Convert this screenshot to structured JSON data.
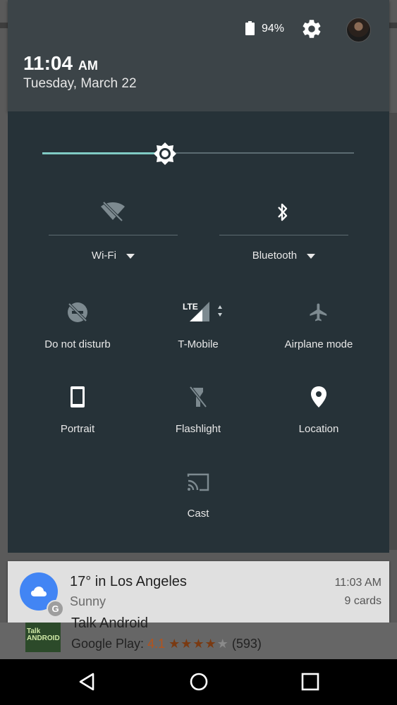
{
  "status_bar": {
    "battery_percent": "94%",
    "battery_icon": "battery-icon",
    "settings_icon": "gear-icon",
    "avatar_icon": "user-avatar"
  },
  "header": {
    "time": "11:04",
    "ampm": "AM",
    "date": "Tuesday, March 22"
  },
  "brightness": {
    "level": 0.4,
    "accent": "#80cbc4"
  },
  "quick_settings": {
    "wifi": {
      "label": "Wi-Fi",
      "icon": "wifi-off-icon"
    },
    "bluetooth": {
      "label": "Bluetooth",
      "icon": "bluetooth-icon"
    },
    "dnd": {
      "label": "Do not disturb",
      "icon": "do-not-disturb-icon"
    },
    "mobile": {
      "label": "T-Mobile",
      "network": "LTE",
      "icon": "cell-signal-icon"
    },
    "airplane": {
      "label": "Airplane mode",
      "icon": "airplane-icon"
    },
    "rotation": {
      "label": "Portrait",
      "icon": "phone-portrait-icon"
    },
    "flashlight": {
      "label": "Flashlight",
      "icon": "flashlight-off-icon"
    },
    "location": {
      "label": "Location",
      "icon": "location-pin-icon"
    },
    "cast": {
      "label": "Cast",
      "icon": "cast-icon"
    }
  },
  "notification": {
    "title": "17° in Los Angeles",
    "subtitle": "Sunny",
    "time": "11:03 AM",
    "cards": "9 cards",
    "badge": "G",
    "accent": "#4285f4"
  },
  "background_app": {
    "name": "Talk Android",
    "icon_text": "Talk\nANDROID",
    "store": "Google Play:",
    "rating": "4.1",
    "stars": "★★★★",
    "half_star": "★",
    "count": "(593)"
  },
  "nav": {
    "back_icon": "back-triangle-icon",
    "home_icon": "home-circle-icon",
    "recents_icon": "recents-square-icon"
  }
}
